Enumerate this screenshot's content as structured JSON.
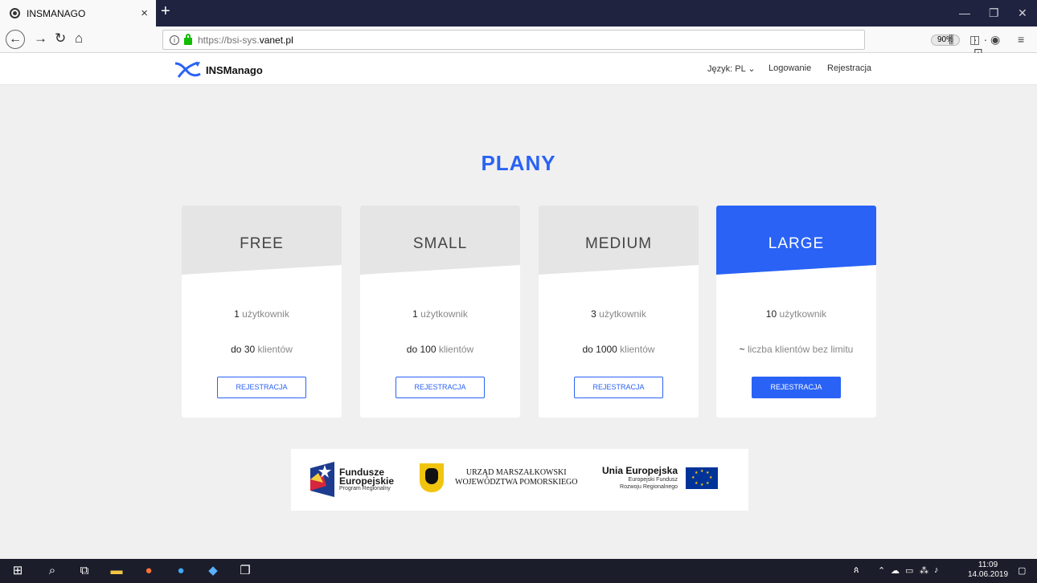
{
  "browser": {
    "tab_title": "INSMANAGO",
    "tab_close": "×",
    "new_tab": "+",
    "url_protocol": "https://",
    "url_prefix": "bsi-sys.",
    "url_host": "vanet.pl",
    "zoom": "90%",
    "page_actions": "··· ⊡ ☆"
  },
  "site": {
    "logo_text": "INSManago",
    "nav": {
      "language": "Język: PL ⌄",
      "login": "Logowanie",
      "register": "Rejestracja"
    },
    "heading": "PLANY",
    "plans": [
      {
        "name": "FREE",
        "users_count": "1",
        "users_label": " użytkownik",
        "clients_prefix": "do ",
        "clients_count": "30",
        "clients_label": " klientów",
        "button": "REJESTRACJA"
      },
      {
        "name": "SMALL",
        "users_count": "1",
        "users_label": " użytkownik",
        "clients_prefix": "do ",
        "clients_count": "100",
        "clients_label": " klientów",
        "button": "REJESTRACJA"
      },
      {
        "name": "MEDIUM",
        "users_count": "3",
        "users_label": " użytkownik",
        "clients_prefix": "do ",
        "clients_count": "1000",
        "clients_label": " klientów",
        "button": "REJESTRACJA"
      },
      {
        "name": "LARGE",
        "users_count": "10",
        "users_label": " użytkownik",
        "clients_prefix": "~ ",
        "clients_count": "",
        "clients_label": "liczba klientów bez limitu",
        "button": "REJESTRACJA"
      }
    ],
    "funding": {
      "fe_line1": "Fundusze",
      "fe_line2": "Europejskie",
      "fe_line3": "Program Regionalny",
      "pom_line1": "URZĄD MARSZAŁKOWSKI",
      "pom_line2": "WOJEWÓDZTWA POMORSKIEGO",
      "ue_line1": "Unia Europejska",
      "ue_line2": "Europejski Fundusz",
      "ue_line3": "Rozwoju Regionalnego"
    }
  },
  "taskbar": {
    "time": "11:09",
    "date": "14.06.2019"
  },
  "colors": {
    "accent": "#2962f5",
    "band_gray": "#e5e5e5",
    "titlebar": "#202340",
    "taskbar": "#1b1d2a"
  }
}
